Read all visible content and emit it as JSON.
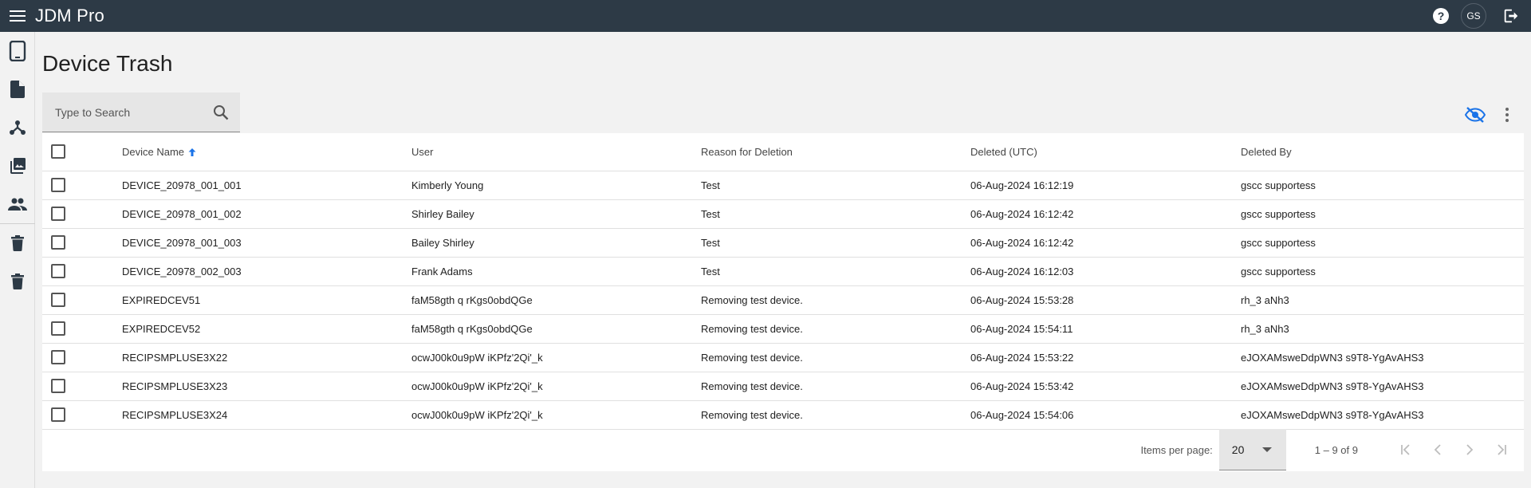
{
  "app": {
    "title": "JDM Pro",
    "user_initials": "GS"
  },
  "sidebar": {
    "items": [
      {
        "icon": "tablet-icon"
      },
      {
        "icon": "document-icon"
      },
      {
        "icon": "hub-icon"
      },
      {
        "icon": "photo-library-icon"
      },
      {
        "icon": "people-icon"
      },
      {
        "icon": "trash-icon"
      },
      {
        "icon": "trash-icon"
      }
    ]
  },
  "page": {
    "title": "Device Trash"
  },
  "search": {
    "placeholder": "Type to Search",
    "value": ""
  },
  "table": {
    "columns": [
      "Device Name",
      "User",
      "Reason for Deletion",
      "Deleted (UTC)",
      "Deleted By"
    ],
    "sort_column": "Device Name",
    "sort_direction": "ascending",
    "rows": [
      [
        "DEVICE_20978_001_001",
        "Kimberly Young",
        "Test",
        "06-Aug-2024 16:12:19",
        "gscc supportess"
      ],
      [
        "DEVICE_20978_001_002",
        "Shirley Bailey",
        "Test",
        "06-Aug-2024 16:12:42",
        "gscc supportess"
      ],
      [
        "DEVICE_20978_001_003",
        "Bailey Shirley",
        "Test",
        "06-Aug-2024 16:12:42",
        "gscc supportess"
      ],
      [
        "DEVICE_20978_002_003",
        "Frank Adams",
        "Test",
        "06-Aug-2024 16:12:03",
        "gscc supportess"
      ],
      [
        "EXPIREDCEV51",
        "faM58gth q rKgs0obdQGe",
        "Removing test device.",
        "06-Aug-2024 15:53:28",
        "rh_3 aNh3"
      ],
      [
        "EXPIREDCEV52",
        "faM58gth q rKgs0obdQGe",
        "Removing test device.",
        "06-Aug-2024 15:54:11",
        "rh_3 aNh3"
      ],
      [
        "RECIPSMPLUSE3X22",
        "ocwJ00k0u9pW iKPfz'2Qi'_k",
        "Removing test device.",
        "06-Aug-2024 15:53:22",
        "eJOXAMsweDdpWN3 s9T8-YgAvAHS3"
      ],
      [
        "RECIPSMPLUSE3X23",
        "ocwJ00k0u9pW iKPfz'2Qi'_k",
        "Removing test device.",
        "06-Aug-2024 15:53:42",
        "eJOXAMsweDdpWN3 s9T8-YgAvAHS3"
      ],
      [
        "RECIPSMPLUSE3X24",
        "ocwJ00k0u9pW iKPfz'2Qi'_k",
        "Removing test device.",
        "06-Aug-2024 15:54:06",
        "eJOXAMsweDdpWN3 s9T8-YgAvAHS3"
      ]
    ]
  },
  "paginator": {
    "items_per_page_label": "Items per page:",
    "items_per_page": "20",
    "range_label": "1 – 9 of 9"
  },
  "colors": {
    "topbar": "#2d3a46",
    "accent": "#1a73e8",
    "page_bg": "#f2f2f2"
  }
}
